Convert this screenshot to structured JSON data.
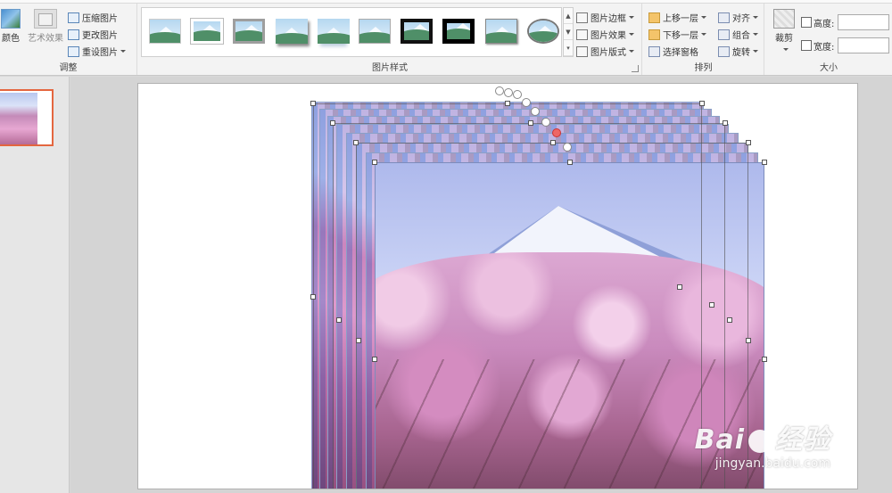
{
  "ribbon": {
    "adjust": {
      "label": "调整",
      "color_label": "颜色",
      "art_effects_label": "艺术效果",
      "compress_label": "压缩图片",
      "change_label": "更改图片",
      "reset_label": "重设图片"
    },
    "styles": {
      "label": "图片样式",
      "border_label": "图片边框",
      "effects_label": "图片效果",
      "layout_label": "图片版式"
    },
    "arrange": {
      "label": "排列",
      "bring_forward_label": "上移一层",
      "send_backward_label": "下移一层",
      "selection_pane_label": "选择窗格",
      "align_label": "对齐",
      "group_label": "组合",
      "rotate_label": "旋转"
    },
    "size": {
      "label": "大小",
      "crop_label": "裁剪",
      "height_label": "高度:",
      "width_label": "宽度:",
      "height_value": "",
      "width_value": ""
    }
  },
  "watermark": {
    "main": "Bai",
    "main2": "经验",
    "sub": "jingyan.baidu.com"
  }
}
